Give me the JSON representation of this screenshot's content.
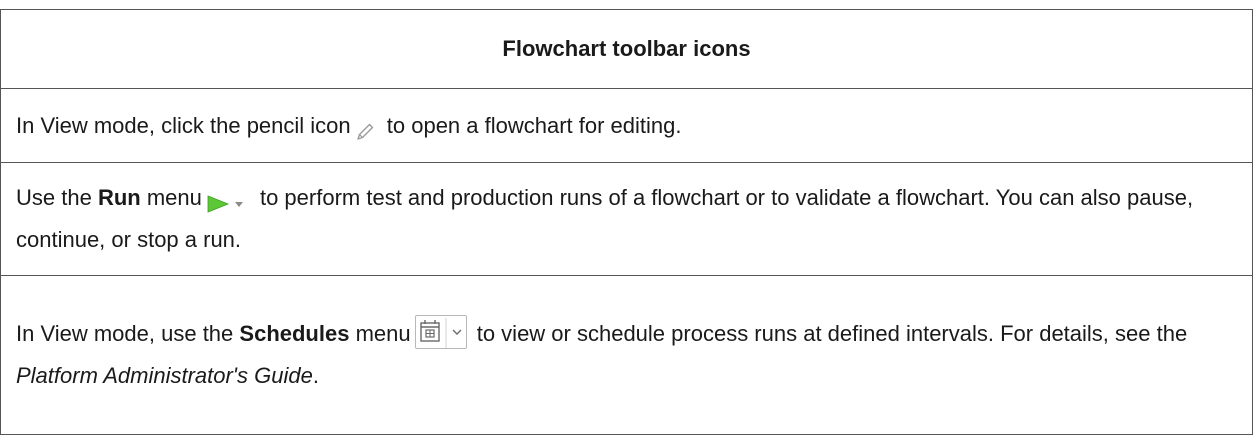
{
  "table": {
    "title": "Flowchart toolbar icons",
    "row1": {
      "before": "In View mode, click the pencil icon",
      "after": " to open a flowchart for editing.",
      "icon": "pencil-icon"
    },
    "row2": {
      "before": "Use the ",
      "bold": "Run",
      "middle": " menu",
      "after": " to perform test and production runs of a flowchart or to validate a flowchart. You can also pause, continue, or stop a run.",
      "icon": "run-menu-icon"
    },
    "row3": {
      "before": "In View mode, use the ",
      "bold": "Schedules",
      "middle": " menu",
      "after": " to view or schedule process runs at defined intervals. For details, see the ",
      "italic": "Platform Administrator's Guide",
      "end": ".",
      "icon": "schedules-menu-icon"
    }
  },
  "colors": {
    "run_green": "#5cc836",
    "border": "#555555"
  }
}
